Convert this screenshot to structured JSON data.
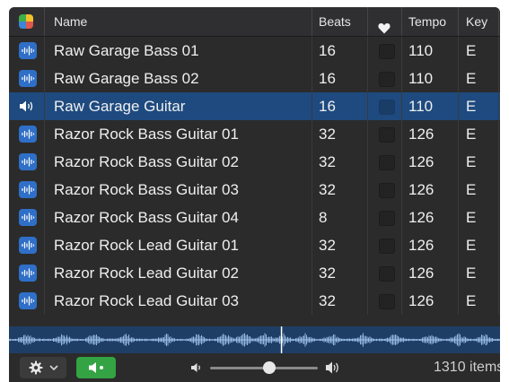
{
  "header": {
    "name_label": "Name",
    "beats_label": "Beats",
    "tempo_label": "Tempo",
    "key_label": "Key",
    "favorite_icon": "heart-icon",
    "view_icon": "grid-icon",
    "grid_colors": [
      "#3fae49",
      "#f2c029",
      "#3b86d8",
      "#e2574c"
    ]
  },
  "rows": [
    {
      "name": "Raw Garage Bass 01",
      "beats": "16",
      "tempo": "110",
      "key": "E",
      "icon": "waveform-icon",
      "selected": false
    },
    {
      "name": "Raw Garage Bass 02",
      "beats": "16",
      "tempo": "110",
      "key": "E",
      "icon": "waveform-icon",
      "selected": false
    },
    {
      "name": "Raw Garage Guitar",
      "beats": "16",
      "tempo": "110",
      "key": "E",
      "icon": "speaker-playing-icon",
      "selected": true
    },
    {
      "name": "Razor Rock Bass Guitar 01",
      "beats": "32",
      "tempo": "126",
      "key": "E",
      "icon": "waveform-icon",
      "selected": false
    },
    {
      "name": "Razor Rock Bass Guitar 02",
      "beats": "32",
      "tempo": "126",
      "key": "E",
      "icon": "waveform-icon",
      "selected": false
    },
    {
      "name": "Razor Rock Bass Guitar 03",
      "beats": "32",
      "tempo": "126",
      "key": "E",
      "icon": "waveform-icon",
      "selected": false
    },
    {
      "name": "Razor Rock Bass Guitar 04",
      "beats": "8",
      "tempo": "126",
      "key": "E",
      "icon": "waveform-icon",
      "selected": false
    },
    {
      "name": "Razor Rock Lead Guitar 01",
      "beats": "32",
      "tempo": "126",
      "key": "E",
      "icon": "waveform-icon",
      "selected": false
    },
    {
      "name": "Razor Rock Lead Guitar 02",
      "beats": "32",
      "tempo": "126",
      "key": "E",
      "icon": "waveform-icon",
      "selected": false
    },
    {
      "name": "Razor Rock Lead Guitar 03",
      "beats": "32",
      "tempo": "126",
      "key": "E",
      "icon": "waveform-icon",
      "selected": false
    }
  ],
  "footer": {
    "gear_icon": "gear-icon",
    "menu_icon": "chevron-down-icon",
    "preview_icon": "speaker-icon",
    "volume_low_icon": "volume-low-icon",
    "volume_high_icon": "volume-high-icon",
    "volume_level": 0.55,
    "items_count": "1310 items"
  },
  "waveform": {
    "playhead_fraction": 0.555
  },
  "colors": {
    "selection": "#1e4a7f",
    "waveform_bg": "#1f3e66",
    "waveform_fg": "#9fc3ea",
    "preview_on": "#33a343",
    "icon_blue": "#2f6fc8"
  }
}
